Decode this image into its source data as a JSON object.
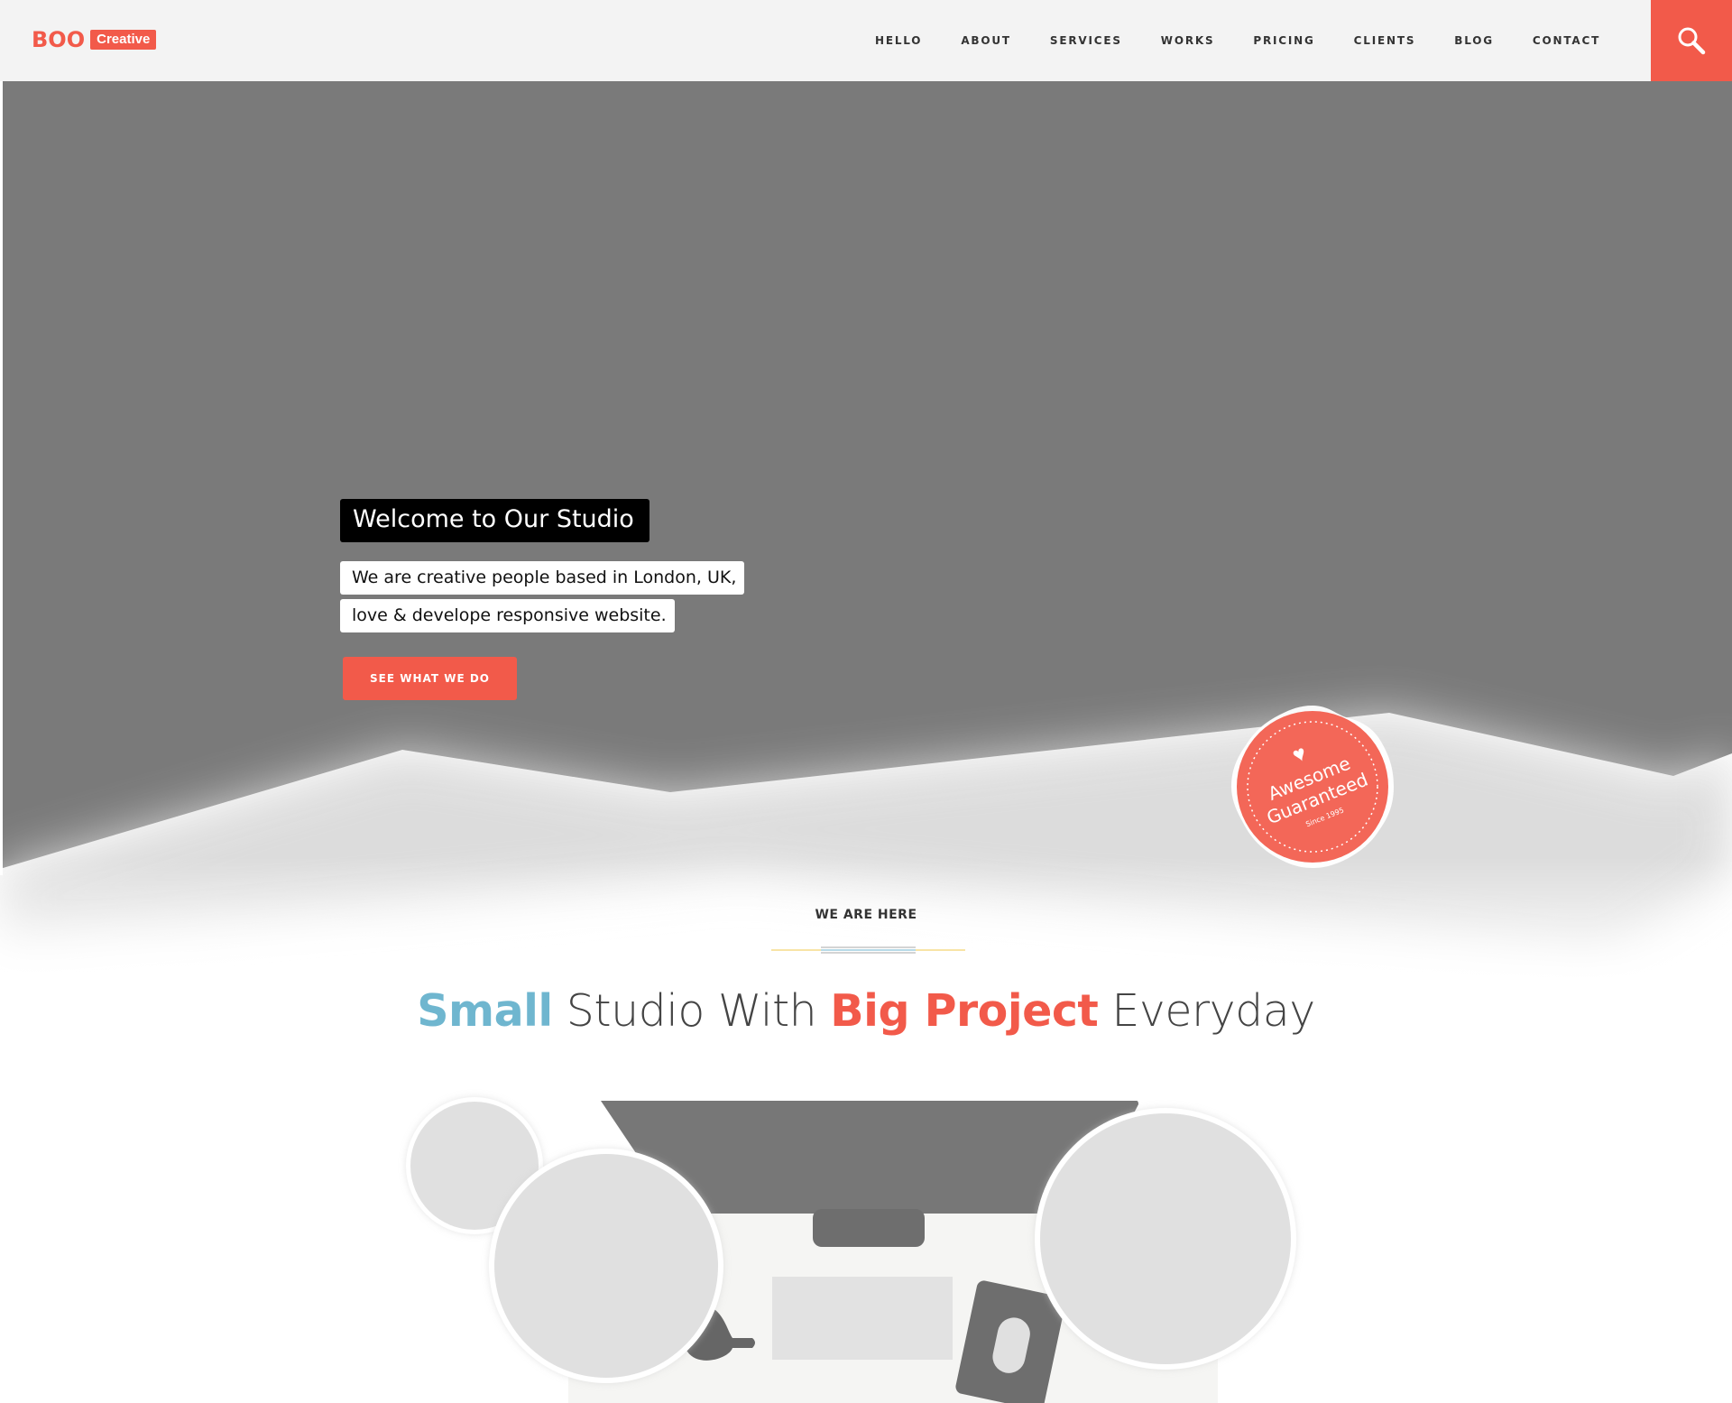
{
  "header": {
    "logo_main": "BOO",
    "logo_tag": "Creative",
    "nav": [
      "HELLO",
      "ABOUT",
      "SERVICES",
      "WORKS",
      "PRICING",
      "CLIENTS",
      "BLOG",
      "CONTACT"
    ],
    "search_icon": "search-icon"
  },
  "hero": {
    "title": "Welcome to Our Studio",
    "line1": "We are creative people based in London, UK,",
    "line2": "love & develope responsive website.",
    "cta": "SEE WHAT WE DO",
    "badge": {
      "icon": "heart-icon",
      "line1": "Awesome",
      "line2": "Guaranteed",
      "small": "Since 1995"
    }
  },
  "intro": {
    "kicker": "WE ARE HERE",
    "headline": {
      "part1": "Small",
      "part2": " Studio With ",
      "part3": "Big Project",
      "part4": " Everyday"
    }
  },
  "colors": {
    "accent": "#f25a4a",
    "blue": "#6fb6cf",
    "hero_bg": "#7a7a7a",
    "header_bg": "#f3f3f3"
  }
}
